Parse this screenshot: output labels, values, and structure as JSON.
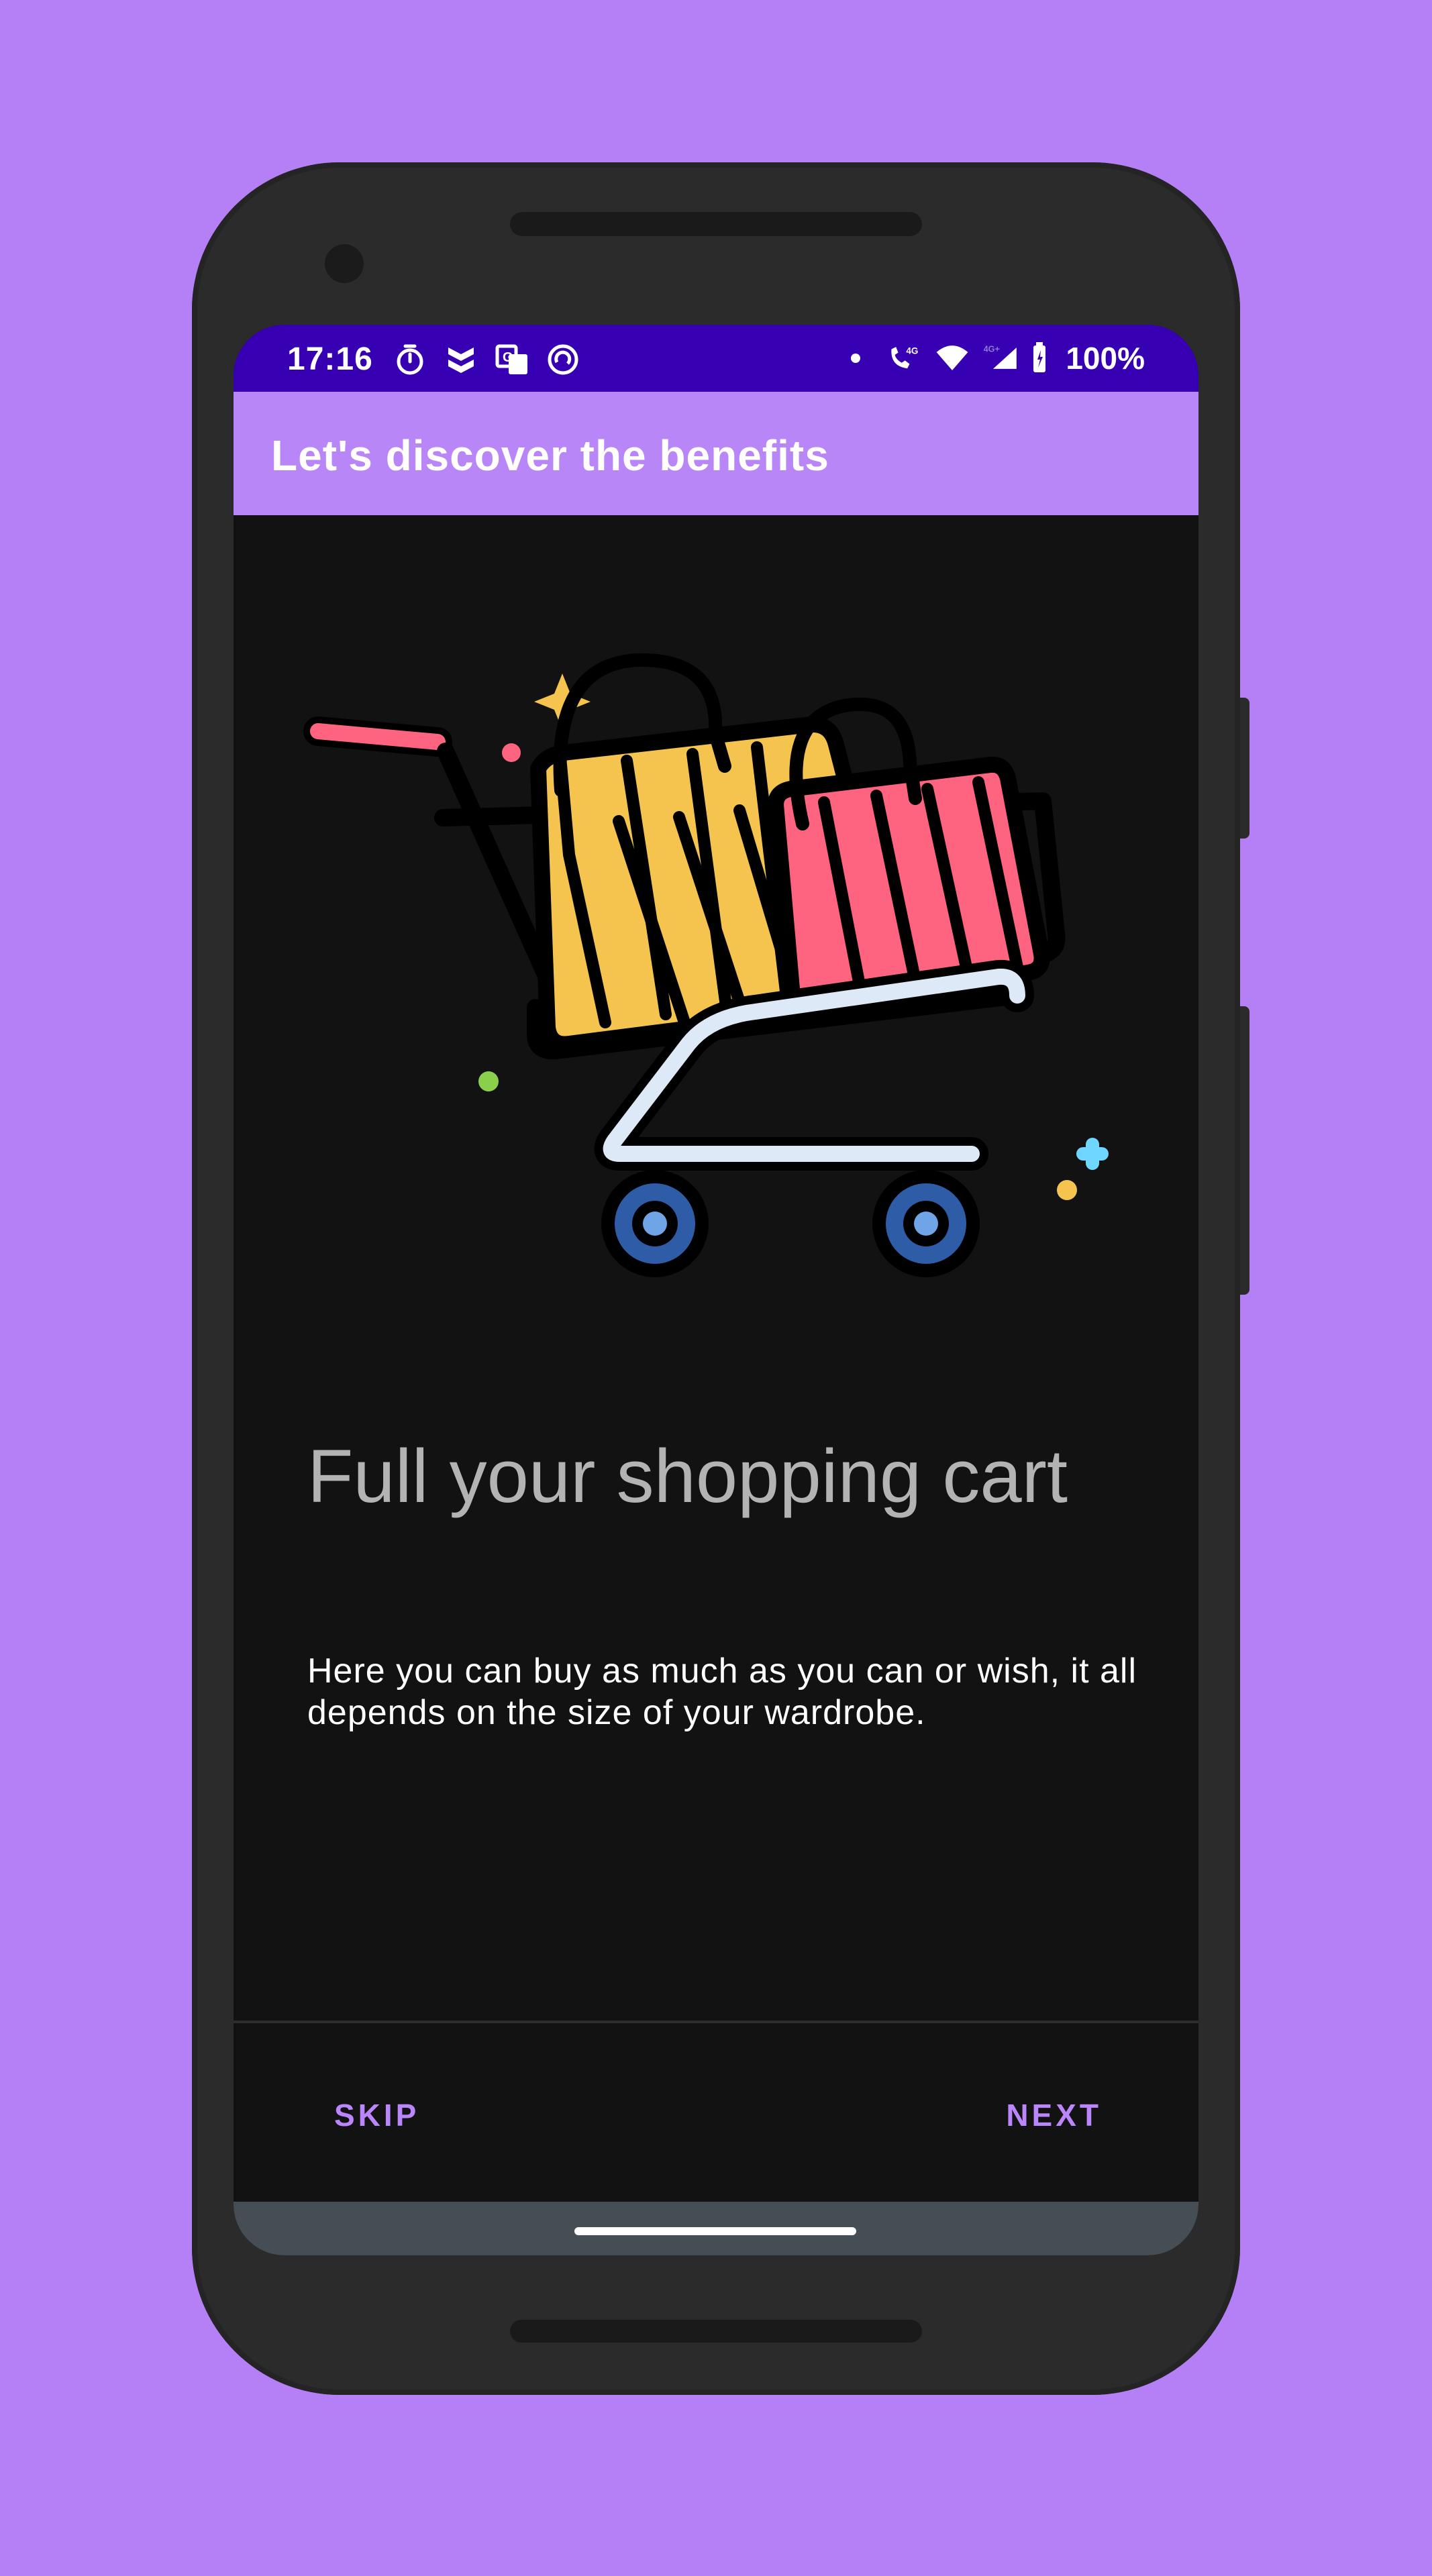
{
  "status_bar": {
    "time": "17:16",
    "battery": "100%",
    "left_icons": [
      "timer-icon",
      "notification-app-icon",
      "translate-icon",
      "sync-icon"
    ],
    "right_icons": [
      "dot-icon",
      "volte-call-icon",
      "wifi-icon",
      "signal-icon",
      "battery-icon"
    ],
    "network_label_call": "4G",
    "network_label_signal": "4G+"
  },
  "app_bar": {
    "title": "Let's discover the benefits"
  },
  "onboarding": {
    "illustration": "shopping-cart-icon",
    "headline": "Full your shopping cart",
    "description": "Here you can buy as much as you can or wish, it all depends on the size of your wardrobe."
  },
  "footer": {
    "skip_label": "SKIP",
    "next_label": "NEXT"
  },
  "colors": {
    "background": "#b580f6",
    "status_bar": "#3700b3",
    "app_bar": "#b986f8",
    "screen": "#121212",
    "accent": "#bb86fc",
    "bag_yellow": "#f5c44f",
    "bag_pink": "#fe647f",
    "wheel_blue": "#2f5ca6"
  }
}
